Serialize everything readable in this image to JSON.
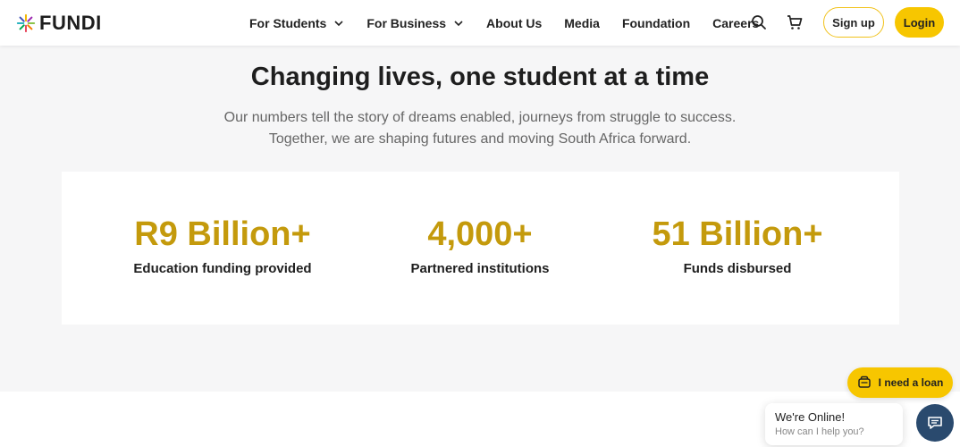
{
  "header": {
    "logo_text": "FUNDI",
    "nav": [
      {
        "label": "For Students",
        "has_dropdown": true
      },
      {
        "label": "For Business",
        "has_dropdown": true
      },
      {
        "label": "About Us",
        "has_dropdown": false
      },
      {
        "label": "Media",
        "has_dropdown": false
      },
      {
        "label": "Foundation",
        "has_dropdown": false
      },
      {
        "label": "Careers",
        "has_dropdown": false
      }
    ],
    "icons": [
      "search-icon",
      "cart-icon"
    ],
    "signup_label": "Sign up",
    "login_label": "Login"
  },
  "hero": {
    "title": "Changing lives, one student at a time",
    "subtitle": "Our numbers tell the story of dreams enabled, journeys from struggle to success. Together, we are shaping futures and moving South Africa forward."
  },
  "stats": [
    {
      "value": "R9 Billion+",
      "label": "Education funding provided"
    },
    {
      "value": "4,000+",
      "label": "Partnered institutions"
    },
    {
      "value": "51 Billion+",
      "label": "Funds disbursed"
    }
  ],
  "floating": {
    "loan_label": "I need a loan",
    "chat_title": "We're Online!",
    "chat_subtitle": "How can I help you?"
  },
  "colors": {
    "accent": "#f7c600",
    "stat_value": "#c49a0c",
    "chat_button": "#2a4a6e",
    "page_background": "#f6f6f7"
  }
}
